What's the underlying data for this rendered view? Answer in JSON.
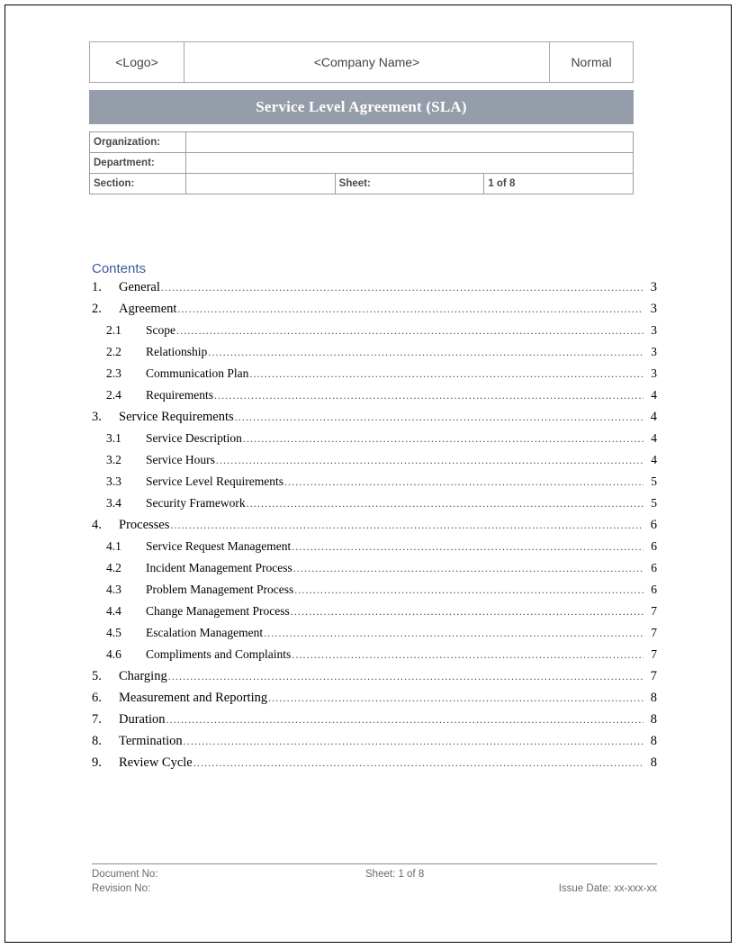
{
  "header": {
    "logo_label": "<Logo>",
    "company_label": "<Company Name>",
    "classification_label": "Normal"
  },
  "title": "Service Level Agreement (SLA)",
  "meta": {
    "organization_label": "Organization:",
    "organization_value": "",
    "department_label": "Department:",
    "department_value": "",
    "section_label": "Section:",
    "section_value": "",
    "sheet_label": "Sheet:",
    "sheet_value": "1 of 8"
  },
  "contents": {
    "heading": "Contents",
    "entries": [
      {
        "number": "1.",
        "label": "General",
        "page": "3",
        "level": 1
      },
      {
        "number": "2.",
        "label": "Agreement",
        "page": "3",
        "level": 1
      },
      {
        "number": "2.1",
        "label": "Scope",
        "page": "3",
        "level": 2
      },
      {
        "number": "2.2",
        "label": "Relationship",
        "page": "3",
        "level": 2
      },
      {
        "number": "2.3",
        "label": "Communication Plan",
        "page": "3",
        "level": 2
      },
      {
        "number": "2.4",
        "label": "Requirements",
        "page": "4",
        "level": 2
      },
      {
        "number": "3.",
        "label": "Service Requirements",
        "page": "4",
        "level": 1
      },
      {
        "number": "3.1",
        "label": "Service Description",
        "page": "4",
        "level": 2
      },
      {
        "number": "3.2",
        "label": "Service Hours",
        "page": "4",
        "level": 2
      },
      {
        "number": "3.3",
        "label": "Service Level Requirements",
        "page": "5",
        "level": 2
      },
      {
        "number": "3.4",
        "label": "Security Framework",
        "page": "5",
        "level": 2
      },
      {
        "number": "4.",
        "label": "Processes",
        "page": "6",
        "level": 1
      },
      {
        "number": "4.1",
        "label": "Service Request Management",
        "page": "6",
        "level": 2
      },
      {
        "number": "4.2",
        "label": "Incident Management Process",
        "page": "6",
        "level": 2
      },
      {
        "number": "4.3",
        "label": "Problem Management Process",
        "page": "6",
        "level": 2
      },
      {
        "number": "4.4",
        "label": "Change Management Process",
        "page": "7",
        "level": 2
      },
      {
        "number": "4.5",
        "label": "Escalation Management",
        "page": "7",
        "level": 2
      },
      {
        "number": "4.6",
        "label": "Compliments and Complaints",
        "page": "7",
        "level": 2
      },
      {
        "number": "5.",
        "label": "Charging",
        "page": "7",
        "level": 1
      },
      {
        "number": "6.",
        "label": "Measurement and Reporting",
        "page": "8",
        "level": 1
      },
      {
        "number": "7.",
        "label": "Duration",
        "page": "8",
        "level": 1
      },
      {
        "number": "8.",
        "label": "Termination",
        "page": "8",
        "level": 1
      },
      {
        "number": "9.",
        "label": "Review Cycle",
        "page": "8",
        "level": 1
      }
    ]
  },
  "footer": {
    "document_no": "Document No:",
    "revision_no": "Revision No:",
    "sheet": "Sheet: 1 of 8",
    "issue_date": "Issue Date: xx-xxx-xx"
  },
  "colors": {
    "title_banner": "#959daa",
    "contents_heading": "#3c5a9a",
    "table_border": "#a6a6a6",
    "footer_text": "#6b6b6b"
  }
}
